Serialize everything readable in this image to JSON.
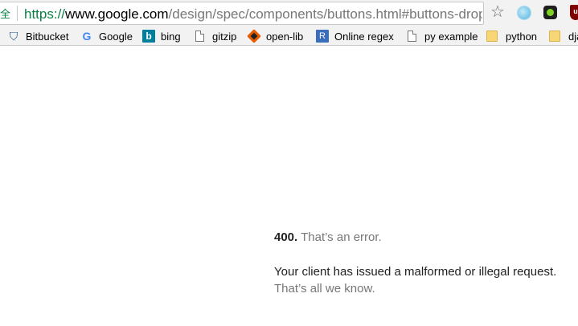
{
  "address_bar": {
    "secure_label": "全",
    "url_scheme": "https://",
    "url_host": "www.google.com",
    "url_path": "/design/spec/components/buttons.html#buttons-dropdo..."
  },
  "toolbar_icons": {
    "bookmark": "star-icon",
    "ext1": "globe-extension-icon",
    "ext2": "green-dot-extension-icon",
    "ext3": "shield-extension-icon"
  },
  "bookmarks": [
    {
      "label": "Bitbucket",
      "icon": "bitbucket-icon"
    },
    {
      "label": "Google",
      "icon": "google-icon"
    },
    {
      "label": "bing",
      "icon": "bing-icon"
    },
    {
      "label": "gitzip",
      "icon": "page-icon"
    },
    {
      "label": "open-lib",
      "icon": "openlib-icon"
    },
    {
      "label": "Online regex",
      "icon": "regex-icon"
    },
    {
      "label": "py example",
      "icon": "page-icon"
    },
    {
      "label": "python",
      "icon": "folder-icon"
    },
    {
      "label": "dja",
      "icon": "folder-icon"
    }
  ],
  "error": {
    "code": "400.",
    "short": "That’s an error.",
    "message": "Your client has issued a malformed or illegal request.",
    "footer": "That’s all we know."
  },
  "colors": {
    "secure": "#0b8043",
    "muted_text": "#777777",
    "chrome_bg": "#f2f2f2"
  }
}
